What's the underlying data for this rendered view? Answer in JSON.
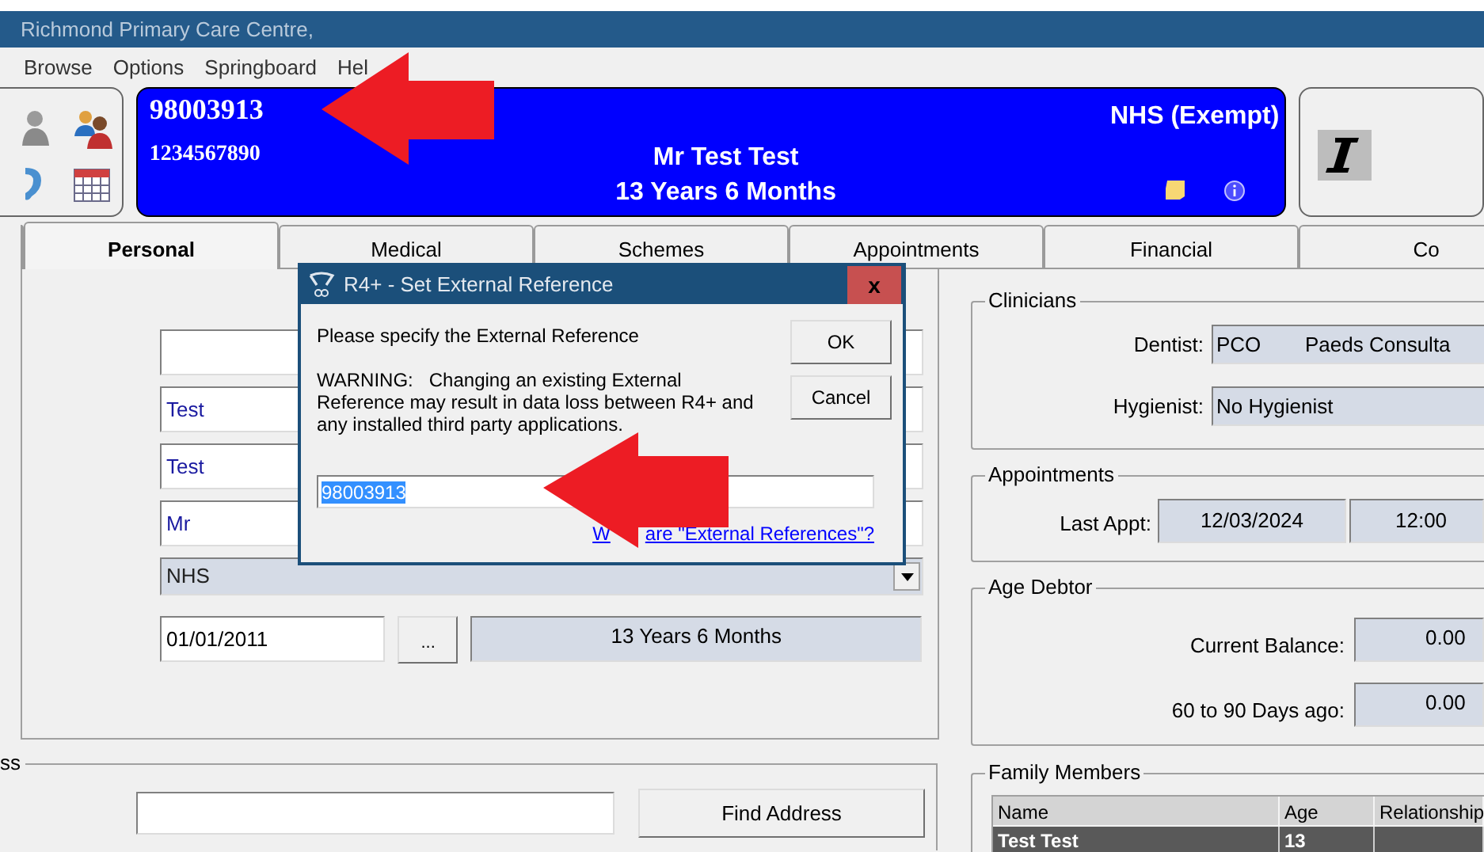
{
  "window": {
    "title": "Richmond Primary Care Centre,"
  },
  "menu": [
    {
      "label": "Browse"
    },
    {
      "label": "Options"
    },
    {
      "label": "Springboard"
    },
    {
      "label": "Hel"
    }
  ],
  "banner": {
    "patient_id": "98003913",
    "nhs_number": "1234567890",
    "status": "NHS (Exempt)",
    "name": "Mr Test Test",
    "age": "13 Years 6 Months"
  },
  "tabs": [
    {
      "label": "Personal",
      "selected": true
    },
    {
      "label": "Medical",
      "selected": false
    },
    {
      "label": "Schemes",
      "selected": false
    },
    {
      "label": "Appointments",
      "selected": false
    },
    {
      "label": "Financial",
      "selected": false
    },
    {
      "label": "Co",
      "selected": false
    }
  ],
  "personal": {
    "fields": [
      {
        "kind": "text"
      },
      {
        "kind": "text",
        "value": "Test"
      },
      {
        "kind": "text",
        "value": "Test"
      },
      {
        "kind": "text",
        "value": "Mr"
      },
      {
        "kind": "select",
        "value": "NHS"
      }
    ],
    "date_of_birth": "01/01/2011",
    "date_button": "...",
    "age": "13 Years 6 Months"
  },
  "address": {
    "legend": "ss",
    "button": "Find Address"
  },
  "clinicians": {
    "legend": "Clinicians",
    "rows": [
      {
        "label": "Dentist:",
        "code": "PCO",
        "value": "Paeds Consulta"
      },
      {
        "label": "Hygienist:",
        "value": "No Hygienist"
      }
    ]
  },
  "appointments": {
    "legend": "Appointments",
    "label": "Last Appt:",
    "date": "12/03/2024",
    "time": "12:00"
  },
  "age_debtor": {
    "legend": "Age Debtor",
    "rows": [
      {
        "label": "Current Balance:",
        "value": "0.00"
      },
      {
        "label": "60 to 90 Days ago:",
        "value": "0.00"
      }
    ]
  },
  "family_members": {
    "legend": "Family Members",
    "columns": [
      "Name",
      "Age",
      "Relationship"
    ],
    "rows": [
      {
        "cells": [
          "Test Test",
          "13"
        ],
        "selected": true
      }
    ]
  },
  "dialog": {
    "title": "R4+ - Set External Reference",
    "close": "x",
    "prompt": "Please specify the External Reference",
    "warning": "WARNING:   Changing an existing External Reference may result in data loss between R4+ and any installed third party applications.",
    "value": "98003913",
    "link_parts": [
      "W",
      "are \"External References\"?"
    ],
    "buttons": [
      "OK",
      "Cancel"
    ]
  }
}
